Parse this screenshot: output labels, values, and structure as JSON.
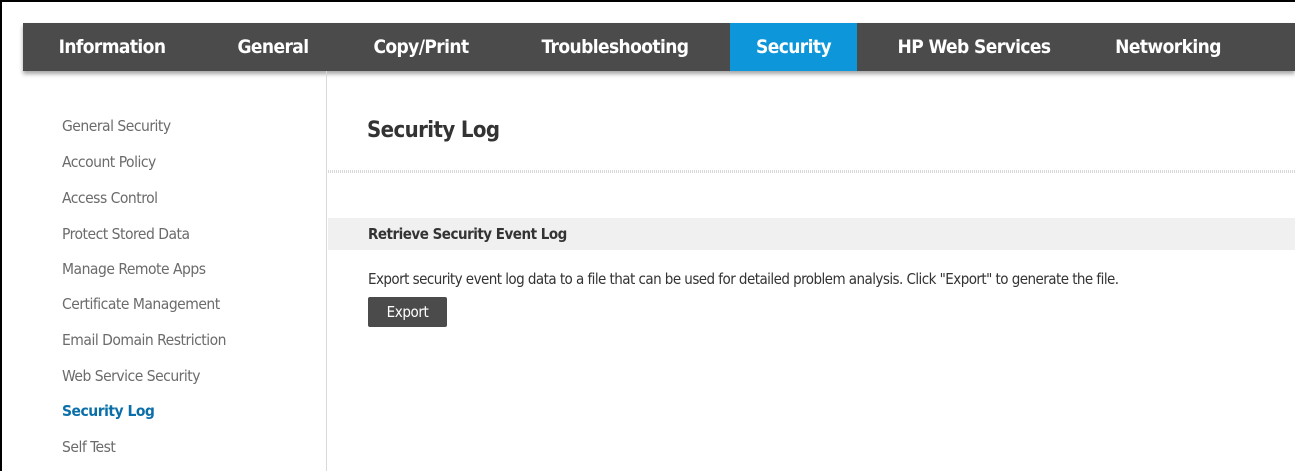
{
  "tabs": [
    {
      "label": "Information"
    },
    {
      "label": "General"
    },
    {
      "label": "Copy/Print"
    },
    {
      "label": "Troubleshooting"
    },
    {
      "label": "Security",
      "active": true
    },
    {
      "label": "HP Web Services"
    },
    {
      "label": "Networking"
    }
  ],
  "sidebar": {
    "items": [
      {
        "label": "General Security"
      },
      {
        "label": "Account Policy"
      },
      {
        "label": "Access Control"
      },
      {
        "label": "Protect Stored Data"
      },
      {
        "label": "Manage Remote Apps"
      },
      {
        "label": "Certificate Management"
      },
      {
        "label": "Email Domain Restriction"
      },
      {
        "label": "Web Service Security"
      },
      {
        "label": "Security Log",
        "active": true
      },
      {
        "label": "Self Test"
      }
    ]
  },
  "main": {
    "title": "Security Log",
    "section_header": "Retrieve Security Event Log",
    "description": "Export security event log data to a file that can be used for detailed problem analysis. Click \"Export\" to generate the file.",
    "export_label": "Export"
  },
  "colors": {
    "tab_bar": "#4b4b4b",
    "active_tab": "#0d96d9",
    "active_sidebar_item": "#0a6fa8",
    "sidebar_item": "#6b6b6b"
  }
}
